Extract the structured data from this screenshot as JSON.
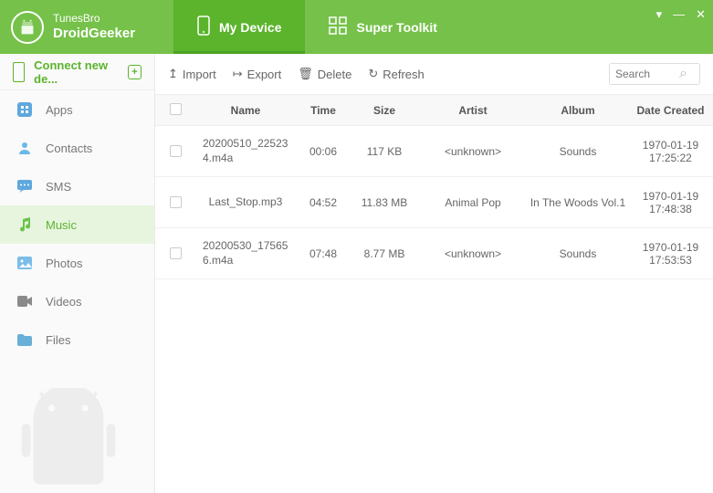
{
  "brand": {
    "line1": "TunesBro",
    "line2": "DroidGeeker"
  },
  "tabs": {
    "device": "My Device",
    "toolkit": "Super Toolkit"
  },
  "sidebar": {
    "connect": "Connect new de...",
    "items": [
      {
        "label": "Apps"
      },
      {
        "label": "Contacts"
      },
      {
        "label": "SMS"
      },
      {
        "label": "Music"
      },
      {
        "label": "Photos"
      },
      {
        "label": "Videos"
      },
      {
        "label": "Files"
      }
    ]
  },
  "toolbar": {
    "import": "Import",
    "export": "Export",
    "delete": "Delete",
    "refresh": "Refresh",
    "search": "Search"
  },
  "tableHeaders": {
    "name": "Name",
    "time": "Time",
    "size": "Size",
    "artist": "Artist",
    "album": "Album",
    "date": "Date Created"
  },
  "rows": [
    {
      "name": "20200510_225234.m4a",
      "time": "00:06",
      "size": "117 KB",
      "artist": "<unknown>",
      "album": "Sounds",
      "date": "1970-01-19 17:25:22"
    },
    {
      "name": "Last_Stop.mp3",
      "time": "04:52",
      "size": "11.83 MB",
      "artist": "Animal Pop",
      "album": "In The Woods Vol.1",
      "date": "1970-01-19 17:48:38"
    },
    {
      "name": "20200530_175656.m4a",
      "time": "07:48",
      "size": "8.77 MB",
      "artist": "<unknown>",
      "album": "Sounds",
      "date": "1970-01-19 17:53:53"
    }
  ]
}
